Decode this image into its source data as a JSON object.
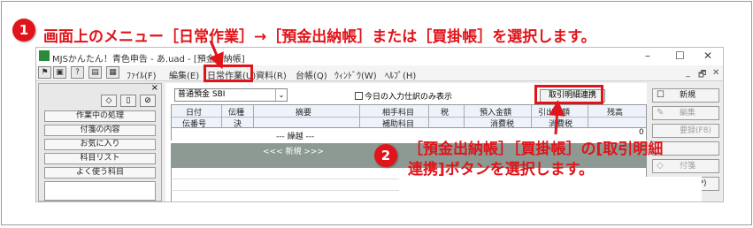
{
  "step1": {
    "number": "1",
    "text": "画面上のメニュー［日常作業］→［預金出納帳］または［買掛帳］を選択します。"
  },
  "step2": {
    "number": "2",
    "line1": "［預金出納帳］［買掛帳］の[取引明細",
    "line2": "連携]ボタンを選択します。"
  },
  "app": {
    "title": "MJSかんたん！青色申告 - あ.uad - [預金出納帳]",
    "window_controls": [
      "–",
      "☐",
      "✕"
    ],
    "mdi_controls": [
      "_",
      "🗗",
      "✕"
    ],
    "menu": [
      "ﾌｧｲﾙ(F)",
      "編集(E)",
      "日常作業(U)",
      "資料(R)",
      "台帳(Q)",
      "ｳｨﾝﾄﾞｳ(W)",
      "ﾍﾙﾌﾟ(H)"
    ]
  },
  "left_pane": {
    "close": "×",
    "items": [
      "作業中の処理",
      "付箋の内容",
      "お気に入り",
      "科目リスト",
      "よく使う科目"
    ]
  },
  "main": {
    "account_select": "普通預金 SBI",
    "checkbox_label": "今日の入力仕訳のみ表示",
    "link_button": "取引明細連携",
    "headers_top": [
      "日付",
      "伝種",
      "摘要",
      "相手科目",
      "税",
      "預入金額",
      "引出金額",
      "残高"
    ],
    "headers_bottom": [
      "伝番号",
      "決",
      "",
      "補助科目",
      "",
      "消費税",
      "消費税",
      ""
    ],
    "carry_row": {
      "label": "--- 繰越 ---",
      "balance": "0"
    },
    "new_row": "<<< 新規 >>>"
  },
  "right_pane": {
    "buttons": [
      {
        "label": "新規",
        "icon": "☐",
        "enabled": true
      },
      {
        "label": "編集",
        "icon": "✎",
        "enabled": false
      },
      {
        "label": "要録(F8)",
        "icon": "",
        "enabled": false
      },
      {
        "label": "",
        "icon": "",
        "enabled": false
      },
      {
        "label": "付箋",
        "icon": "◇",
        "enabled": false
      },
      {
        "label": "印刷(P)",
        "icon": "🖶",
        "enabled": true
      }
    ]
  },
  "colors": {
    "accent": "#e0141a",
    "header_bg": "#eef3fb",
    "new_row_bg": "#8c9a93"
  }
}
